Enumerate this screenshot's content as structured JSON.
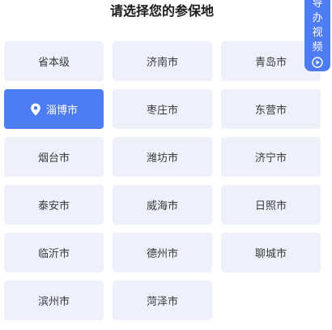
{
  "page": {
    "title": "请选择您的参保地"
  },
  "cities": [
    {
      "name": "省本级",
      "selected": false
    },
    {
      "name": "济南市",
      "selected": false
    },
    {
      "name": "青岛市",
      "selected": false
    },
    {
      "name": "淄博市",
      "selected": true
    },
    {
      "name": "枣庄市",
      "selected": false
    },
    {
      "name": "东营市",
      "selected": false
    },
    {
      "name": "烟台市",
      "selected": false
    },
    {
      "name": "潍坊市",
      "selected": false
    },
    {
      "name": "济宁市",
      "selected": false
    },
    {
      "name": "泰安市",
      "selected": false
    },
    {
      "name": "威海市",
      "selected": false
    },
    {
      "name": "日照市",
      "selected": false
    },
    {
      "name": "临沂市",
      "selected": false
    },
    {
      "name": "德州市",
      "selected": false
    },
    {
      "name": "聊城市",
      "selected": false
    },
    {
      "name": "滨州市",
      "selected": false
    },
    {
      "name": "菏泽市",
      "selected": false
    }
  ],
  "side_tab": {
    "chars": [
      "导",
      "办",
      "视",
      "频"
    ],
    "icon": "play-circle-icon"
  },
  "colors": {
    "accent": "#4d7cf3",
    "tile_bg": "#eef1fb",
    "text": "#3a3a3a"
  }
}
